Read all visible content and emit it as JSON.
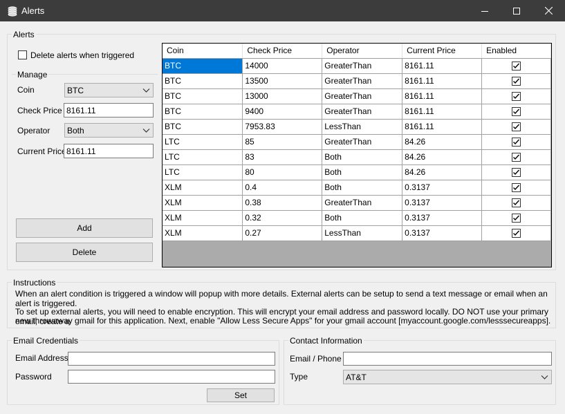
{
  "window": {
    "title": "Alerts"
  },
  "alerts_group": {
    "label": "Alerts",
    "delete_when_triggered_label": "Delete alerts when triggered",
    "manage": {
      "label": "Manage",
      "coin_label": "Coin",
      "coin_value": "BTC",
      "check_price_label": "Check Price",
      "check_price_value": "8161.11",
      "operator_label": "Operator",
      "operator_value": "Both",
      "current_price_label": "Current Price",
      "current_price_value": "8161.11"
    },
    "add_label": "Add",
    "delete_label": "Delete"
  },
  "grid": {
    "columns": [
      "Coin",
      "Check Price",
      "Operator",
      "Current Price",
      "Enabled"
    ],
    "rows": [
      [
        "BTC",
        "14000",
        "GreaterThan",
        "8161.11"
      ],
      [
        "BTC",
        "13500",
        "GreaterThan",
        "8161.11"
      ],
      [
        "BTC",
        "13000",
        "GreaterThan",
        "8161.11"
      ],
      [
        "BTC",
        "9400",
        "GreaterThan",
        "8161.11"
      ],
      [
        "BTC",
        "7953.83",
        "LessThan",
        "8161.11"
      ],
      [
        "LTC",
        "85",
        "GreaterThan",
        "84.26"
      ],
      [
        "LTC",
        "83",
        "Both",
        "84.26"
      ],
      [
        "LTC",
        "80",
        "Both",
        "84.26"
      ],
      [
        "XLM",
        "0.4",
        "Both",
        "0.3137"
      ],
      [
        "XLM",
        "0.38",
        "GreaterThan",
        "0.3137"
      ],
      [
        "XLM",
        "0.32",
        "Both",
        "0.3137"
      ],
      [
        "XLM",
        "0.27",
        "LessThan",
        "0.3137"
      ]
    ]
  },
  "instructions": {
    "label": "Instructions",
    "line1": "When an alert condition is triggered a window will popup with more details. External alerts can be setup to send a text message or email when an alert is triggered.",
    "line2": "To set up external alerts, you will need to enable encryption. This will encrypt your email address and password locally. DO NOT use your primary email, create a",
    "line3": "new throwaway gmail for this application. Next, enable \"Allow Less Secure Apps\" for your gmail account [myaccount.google.com/lesssecureapps]."
  },
  "email_credentials": {
    "label": "Email Credentials",
    "email_label": "Email Address",
    "email_value": "",
    "password_label": "Password",
    "password_value": "",
    "set_label": "Set"
  },
  "contact": {
    "label": "Contact Information",
    "email_phone_label": "Email / Phone",
    "email_phone_value": "",
    "type_label": "Type",
    "type_value": "AT&T"
  }
}
